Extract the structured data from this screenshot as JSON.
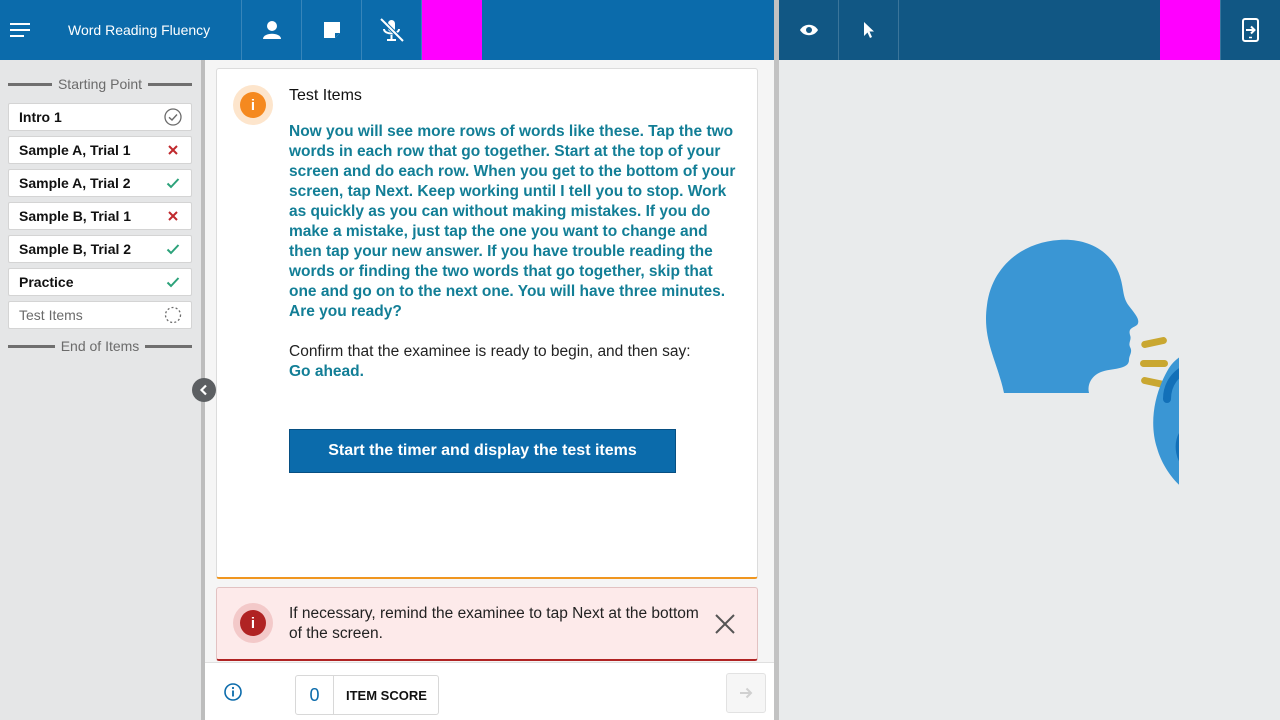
{
  "header": {
    "app_title": "Word Reading Fluency",
    "icons": [
      "menu-icon",
      "person-icon",
      "note-icon",
      "mic-off-icon",
      "eye-icon",
      "cursor-icon",
      "exit-icon"
    ],
    "accent_color": "#0b6bab",
    "highlight_color": "#ff00ff"
  },
  "sidebar": {
    "start_label": "Starting Point",
    "end_label": "End of Items",
    "items": [
      {
        "label": "Intro 1",
        "status": "complete"
      },
      {
        "label": "Sample A, Trial 1",
        "status": "incorrect"
      },
      {
        "label": "Sample A, Trial 2",
        "status": "correct"
      },
      {
        "label": "Sample B, Trial 1",
        "status": "incorrect"
      },
      {
        "label": "Sample B, Trial 2",
        "status": "correct"
      },
      {
        "label": "Practice",
        "status": "correct"
      },
      {
        "label": "Test Items",
        "status": "in-progress"
      }
    ]
  },
  "card": {
    "title": "Test Items",
    "script": "Now you will see more rows of words like these. Tap the two words in each row that go together. Start at the top of your screen and do each row. When you get to the bottom of your screen, tap Next. Keep working until I tell you to stop. Work as quickly as you can without making mistakes. If you do make a mistake, just tap the one you want to change and then tap your new answer. If you have trouble reading the words or finding the two words that go together, skip that one and go on to the next one. You will have three minutes. Are you ready?",
    "instruction": "Confirm that the examinee is ready to begin, and then say:",
    "say": "Go ahead.",
    "button_label": "Start the timer and display the test items"
  },
  "alert": {
    "text": "If necessary, remind the examinee to tap Next at the bottom of the screen."
  },
  "footer": {
    "score_value": "0",
    "score_label": "ITEM SCORE"
  }
}
